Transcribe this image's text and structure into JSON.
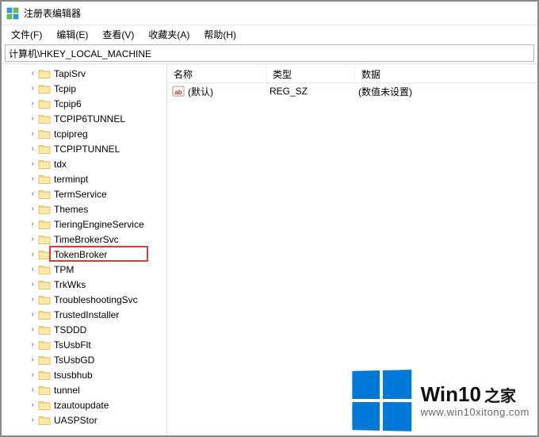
{
  "window": {
    "title": "注册表编辑器"
  },
  "menu": {
    "file": "文件(F)",
    "edit": "编辑(E)",
    "view": "查看(V)",
    "favorites": "收藏夹(A)",
    "help": "帮助(H)"
  },
  "address": {
    "path": "计算机\\HKEY_LOCAL_MACHINE"
  },
  "tree": {
    "items": [
      {
        "label": "TapiSrv",
        "expandable": true
      },
      {
        "label": "Tcpip",
        "expandable": true
      },
      {
        "label": "Tcpip6",
        "expandable": true
      },
      {
        "label": "TCPIP6TUNNEL",
        "expandable": true
      },
      {
        "label": "tcpipreg",
        "expandable": true
      },
      {
        "label": "TCPIPTUNNEL",
        "expandable": true
      },
      {
        "label": "tdx",
        "expandable": true
      },
      {
        "label": "terminpt",
        "expandable": true
      },
      {
        "label": "TermService",
        "expandable": true
      },
      {
        "label": "Themes",
        "expandable": true
      },
      {
        "label": "TieringEngineService",
        "expandable": true
      },
      {
        "label": "TimeBrokerSvc",
        "expandable": true
      },
      {
        "label": "TokenBroker",
        "expandable": true,
        "highlighted": true
      },
      {
        "label": "TPM",
        "expandable": true
      },
      {
        "label": "TrkWks",
        "expandable": true
      },
      {
        "label": "TroubleshootingSvc",
        "expandable": true
      },
      {
        "label": "TrustedInstaller",
        "expandable": true
      },
      {
        "label": "TSDDD",
        "expandable": true
      },
      {
        "label": "TsUsbFlt",
        "expandable": true
      },
      {
        "label": "TsUsbGD",
        "expandable": true
      },
      {
        "label": "tsusbhub",
        "expandable": true
      },
      {
        "label": "tunnel",
        "expandable": true
      },
      {
        "label": "tzautoupdate",
        "expandable": true
      },
      {
        "label": "UASPStor",
        "expandable": true
      }
    ]
  },
  "list": {
    "headers": {
      "name": "名称",
      "type": "类型",
      "data": "数据"
    },
    "rows": [
      {
        "name": "(默认)",
        "type": "REG_SZ",
        "data": "(数值未设置)"
      }
    ]
  },
  "watermark": {
    "brand": "Win10",
    "suffix": "之家",
    "url": "www.win10xitong.com"
  }
}
